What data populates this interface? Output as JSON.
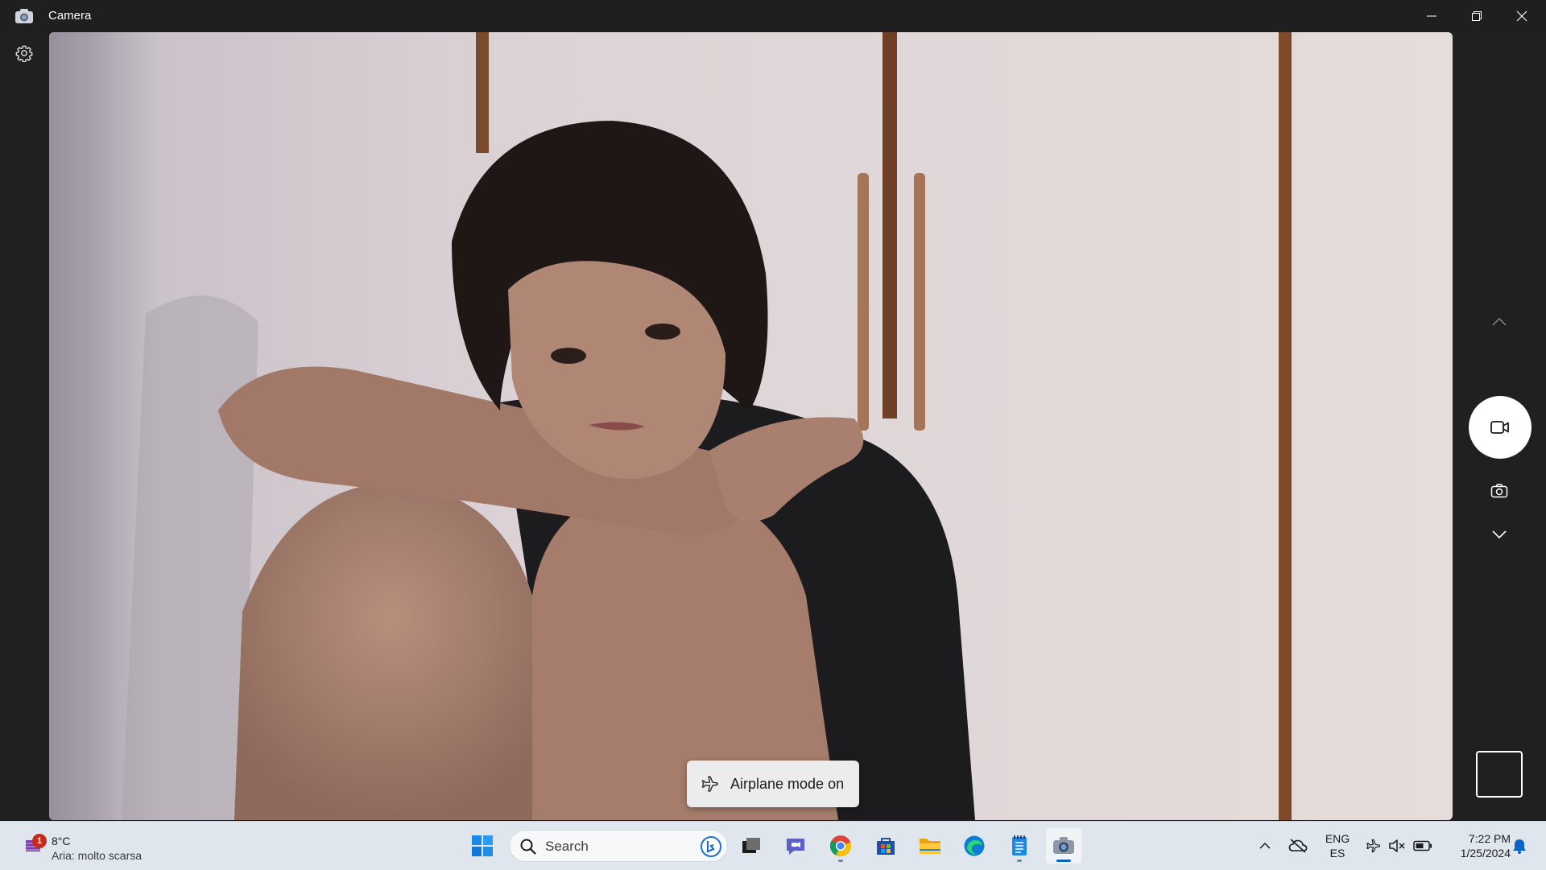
{
  "window": {
    "title": "Camera"
  },
  "toast": {
    "text": "Airplane mode on"
  },
  "taskbar": {
    "weather": {
      "temp": "8°C",
      "description": "Aria: molto scarsa",
      "badge": "1"
    },
    "search": {
      "placeholder": "Search"
    },
    "pinned_apps": [
      "start-icon",
      "search",
      "task-view-icon",
      "teams-chat-icon",
      "chrome-icon",
      "store-icon",
      "file-explorer-icon",
      "edge-icon",
      "notepad-icon",
      "camera-icon"
    ],
    "language": {
      "line1": "ENG",
      "line2": "ES"
    },
    "clock": {
      "time": "7:22 PM",
      "date": "1/25/2024"
    }
  },
  "colors": {
    "accent": "#0a64c8",
    "titlebar": "#1f1f1f",
    "taskbar": "#dfe6ee"
  }
}
